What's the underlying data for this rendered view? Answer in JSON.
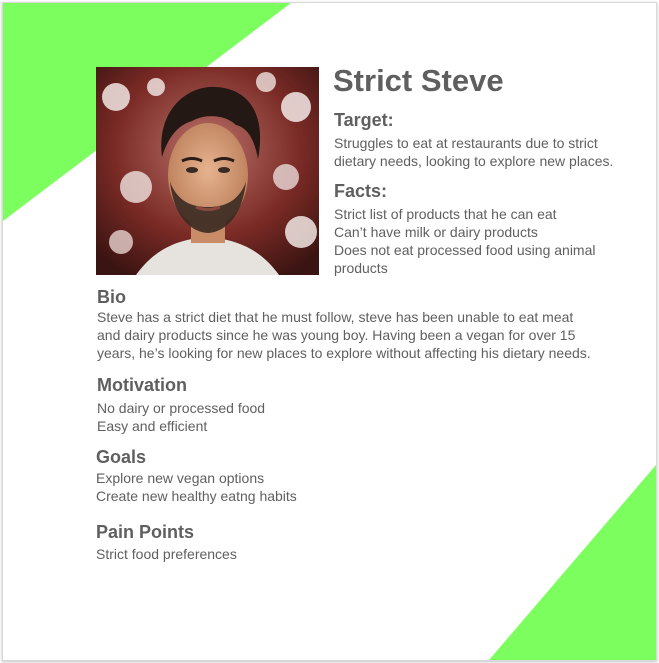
{
  "colors": {
    "accent": "#7cff5e",
    "text": "#5f5f5f"
  },
  "persona": {
    "name": "Strict Steve",
    "photo": {
      "icon": "portrait-photo"
    },
    "target": {
      "heading": "Target:",
      "lines": [
        "Struggles to eat at restaurants due to strict",
        "dietary needs, looking to explore new places."
      ]
    },
    "facts": {
      "heading": "Facts:",
      "lines": [
        "Strict list of products that he can eat",
        "Can’t have milk or dairy products",
        "Does not eat processed food using animal",
        "products"
      ]
    },
    "bio": {
      "heading": "Bio",
      "lines": [
        "Steve has a strict diet that he must follow, steve has been unable to eat meat",
        "and dairy products since he was young boy. Having been a vegan for over 15",
        "years, he’s looking for new places to explore without affecting his dietary needs."
      ]
    },
    "motivation": {
      "heading": "Motivation",
      "lines": [
        "No dairy or processed food",
        "Easy and efficient"
      ]
    },
    "goals": {
      "heading": "Goals",
      "lines": [
        "Explore new vegan options",
        "Create new healthy eatng habits"
      ]
    },
    "pain_points": {
      "heading": "Pain Points",
      "lines": [
        "Strict food preferences"
      ]
    }
  }
}
